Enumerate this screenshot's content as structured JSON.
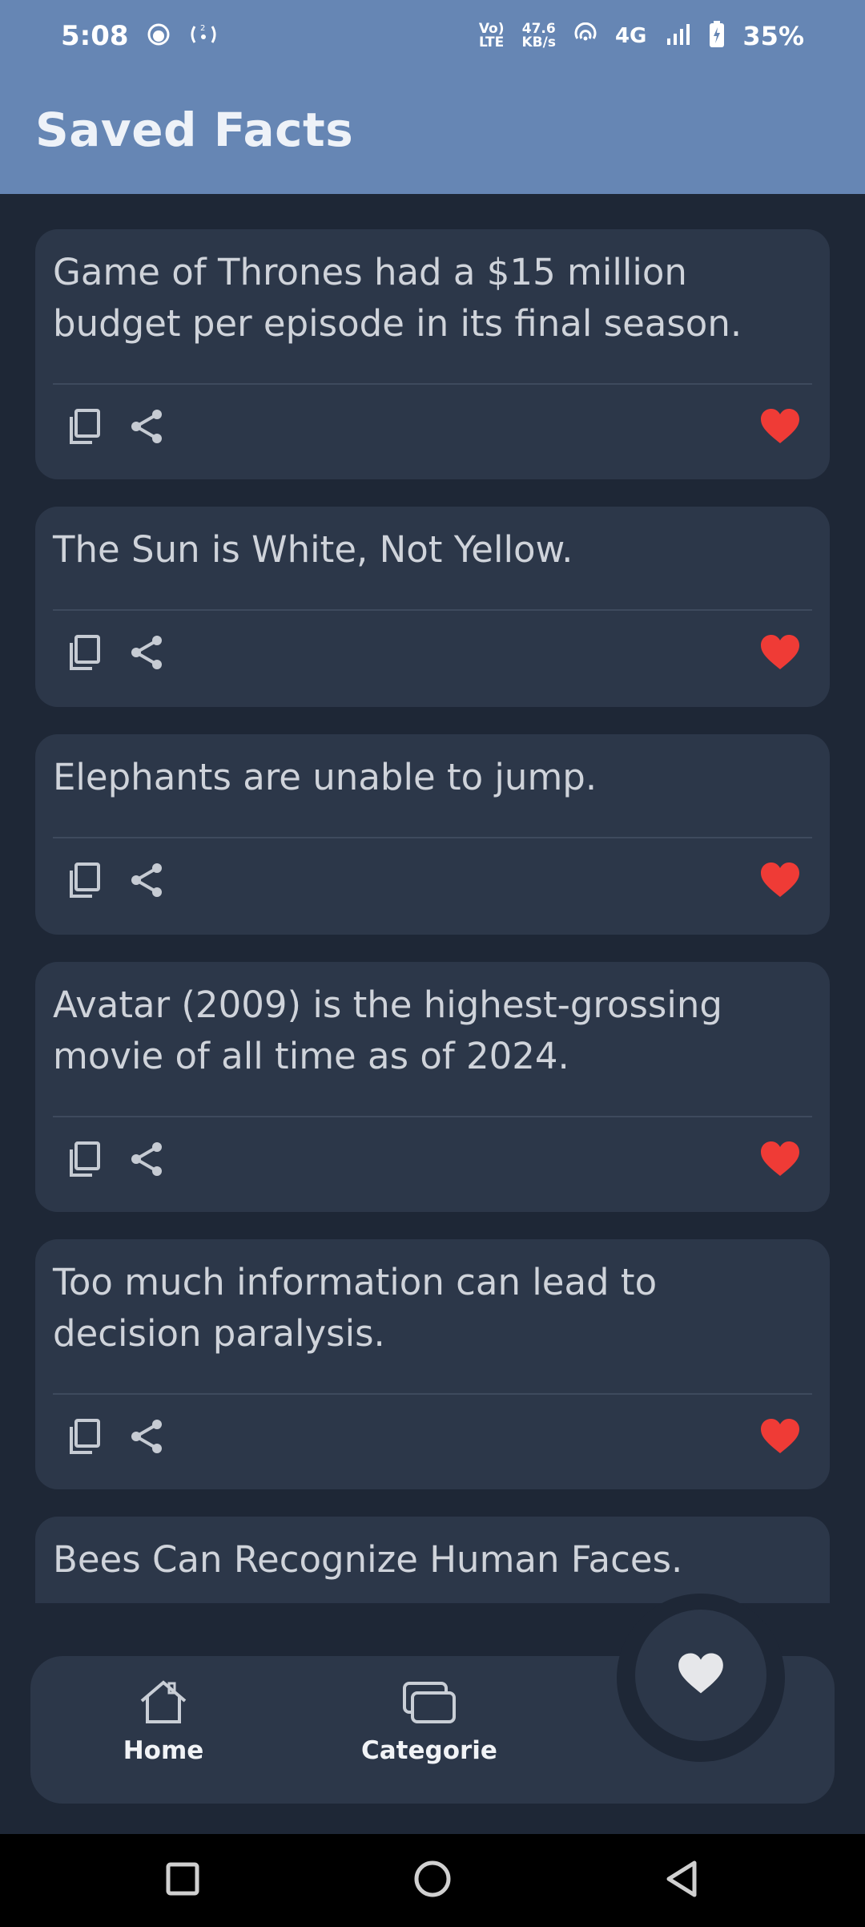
{
  "status_bar": {
    "time": "5:08",
    "volte_top": "Vo)",
    "volte_bottom": "LTE",
    "speed_value": "47.6",
    "speed_unit": "KB/s",
    "network": "4G",
    "battery_percent": "35%"
  },
  "app_bar": {
    "title": "Saved Facts"
  },
  "facts": [
    {
      "text": "Game of Thrones had a $15 million budget per episode in its final season.",
      "favorited": true
    },
    {
      "text": "The Sun is White, Not Yellow.",
      "favorited": true
    },
    {
      "text": "Elephants are unable to jump.",
      "favorited": true
    },
    {
      "text": "Avatar (2009) is the highest-grossing movie of all time as of 2024.",
      "favorited": true
    },
    {
      "text": "Too much information can lead to decision paralysis.",
      "favorited": true
    },
    {
      "text": "Bees Can Recognize Human Faces.",
      "favorited": true
    }
  ],
  "bottom_nav": {
    "home_label": "Home",
    "categories_label": "Categorie",
    "active": "saved"
  },
  "colors": {
    "app_bar": "#6686b4",
    "background": "#1e2736",
    "card": "#2c3749",
    "heart": "#ef3b36"
  },
  "icons": {
    "copy": "copy-icon",
    "share": "share-icon",
    "favorite": "heart-icon",
    "home": "home-icon",
    "categories": "cards-icon"
  }
}
